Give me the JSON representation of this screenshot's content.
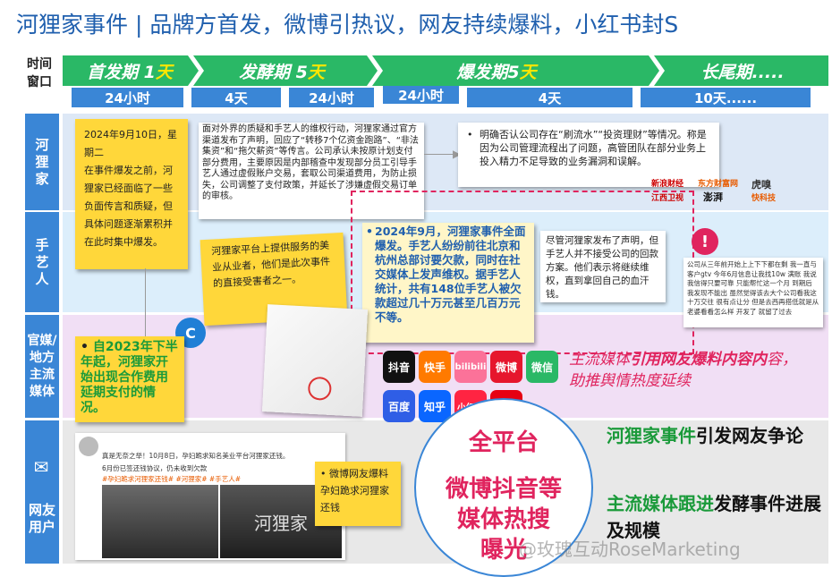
{
  "title": "河狸家事件 | 品牌方首发，微博引热议，网友持续爆料，小红书封S",
  "timeline": {
    "label": "时间\n窗口",
    "phases": [
      {
        "label": "首发期 1",
        "suffix": "天"
      },
      {
        "label": "发酵期 5",
        "suffix": "天"
      },
      {
        "label": "爆发期5",
        "suffix": "天"
      },
      {
        "label": "长尾期.....",
        "suffix": ""
      }
    ],
    "durations": [
      "24小时",
      "4天",
      "24小时",
      "24小时",
      "4天",
      "10天......"
    ]
  },
  "lanes": [
    "河\n狸\n家",
    "手\n艺\n人",
    "官媒/\n地方\n主流\n媒体",
    "网友\n用户"
  ],
  "notes": {
    "date_note": "2024年9月10日，星期二\n在事件爆发之前，河狸家已经面临了一些负面传言和质疑，但具体问题逐渐累积并在此时集中爆发。",
    "statement_note": "面对外界的质疑和手艺人的维权行动，河狸家通过官方渠道发布了声明，回应了“转移7个亿资金跑路”、“非法集资”和“拖欠薪资”等传言。公司承认未按原计划支付部分费用，主要原因是内部稽查中发现部分员工引导手艺人通过虚假账户交易，套取公司渠道费用，为防止损失，公司调整了支付政策，并延长了涉嫌虚假交易订单的审核。",
    "fraud_note": "明确否认公司存在“刷流水”“投资理财”等情况。称是因为公司管理流程出了问题，高管团队在部分业务上投入精力不足导致的业务漏洞和误解。",
    "platform_note": "河狸家平台上提供服务的美业从业者，他们是此次事件的直接受害者之一。",
    "outbreak_note": "2024年9月，河狸家事件全面爆发。手艺人纷纷前往北京和杭州总部讨要欠款，同时在社交媒体上发声维权。据手艺人统计，共有148位手艺人被欠款超过几十万元甚至几百万元不等。",
    "despite_note": "尽管河狸家发布了声明，但手艺人并不接受公司的回款方案。他们表示将继续维权，直到拿回自己的血汗钱。",
    "delay_note": "自2023年下半年起，河狸家开始出现合作费用延期支付的情况。",
    "weibo_note": "微博网友爆料孕妇跪求河狸家还钱",
    "complaint_text": "公司从三年前开始上上下下都在剩 我一直与客户gtv 今年6月信息让我找10w 满账 我说我信得只要可靠 只能帮忙这一个月 到期后 我发现不能出 虽然觉得该去大个公司看我这十万交往 很有点让分 但是去西再搭低就是从老婆看看怎么样 开发了 就留了过去"
  },
  "news_logos": [
    "新浪财经",
    "东方财富网",
    "江西卫视",
    "澎湃",
    "虎嗅",
    "快科技"
  ],
  "media_apps": [
    "抖音",
    "快手",
    "bilibili",
    "微博",
    "微信",
    "百度",
    "知乎",
    "小红书",
    "头条"
  ],
  "media_text": "主流媒体引用网友爆料内容内容，助推舆情热度延续",
  "media_text_parts": [
    "主流媒体",
    "引用网友爆料内容内",
    "容，助推舆情热度延续"
  ],
  "center_text": {
    "line1": "全平台",
    "line2": "微博抖音等\n媒体热搜\n曝光"
  },
  "right_text": {
    "a_green": "河狸家事件",
    "a_black": "引发网友争论",
    "b_green": "主流媒体跟进",
    "b_black": "发酵事件进展及规模"
  },
  "post": {
    "line1": "真是无奈之举！10月8日，孕妇跪求知名美业平台河狸家还钱。",
    "line2": "6月份已签还钱协议，仍未收到欠款",
    "tags": "#孕妇跪求河狸家还钱# #河狸家# #手艺人#",
    "sign": "河狸家"
  },
  "watermark": "@玫瑰互动RoseMarketing",
  "colors": {
    "blue": "#3a86d6",
    "green": "#2ab866",
    "yellow": "#ffd73a",
    "pink": "#e0245e",
    "darkblue": "#1f5fae"
  }
}
